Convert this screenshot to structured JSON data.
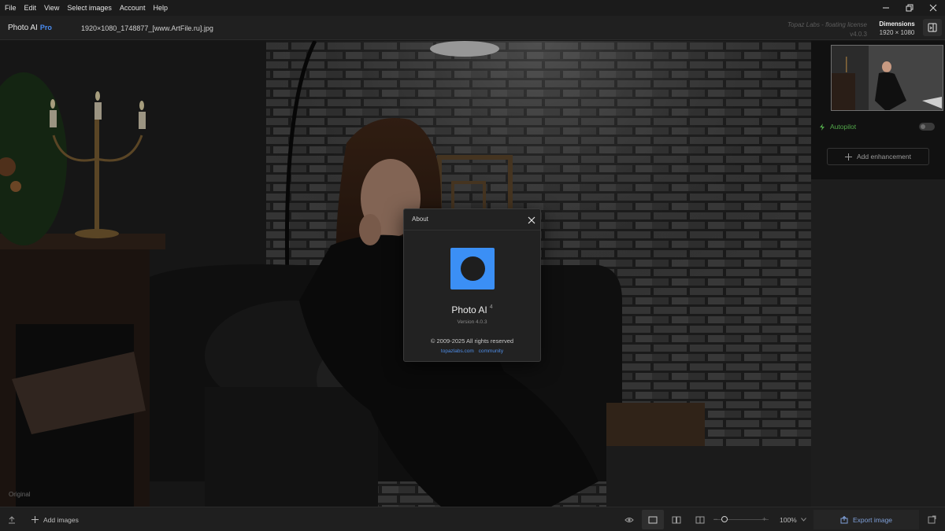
{
  "menubar": {
    "items": [
      "File",
      "Edit",
      "View",
      "Select images",
      "Account",
      "Help"
    ]
  },
  "window_controls": [
    "minimize-icon",
    "restore-icon",
    "close-icon"
  ],
  "header": {
    "app_name": "Photo AI",
    "app_edition": "Pro",
    "filename": "1920×1080_1748877_[www.ArtFile.ru].jpg",
    "license_text": "Topaz Labs - floating license",
    "version": "v4.0.3",
    "dimensions_label": "Dimensions",
    "dimensions_value": "1920 × 1080"
  },
  "canvas": {
    "label": "Original"
  },
  "right_panel": {
    "autopilot_label": "Autopilot",
    "autopilot_enabled": false,
    "add_enhancement_label": "Add enhancement"
  },
  "bottombar": {
    "add_images_label": "Add images",
    "zoom_value": "100%",
    "zoom_fraction": 0.15,
    "export_label": "Export image"
  },
  "about_dialog": {
    "title": "About",
    "product_name": "Photo AI",
    "product_major": "4",
    "version_text": "Version 4.0.3",
    "copyright": "© 2009-2025 All rights reserved",
    "link_site": "topazlabs.com",
    "link_community": "community"
  },
  "colors": {
    "accent": "#3b8ff5",
    "autopilot_green": "#52a84a",
    "link_blue": "#4f8ee8"
  }
}
